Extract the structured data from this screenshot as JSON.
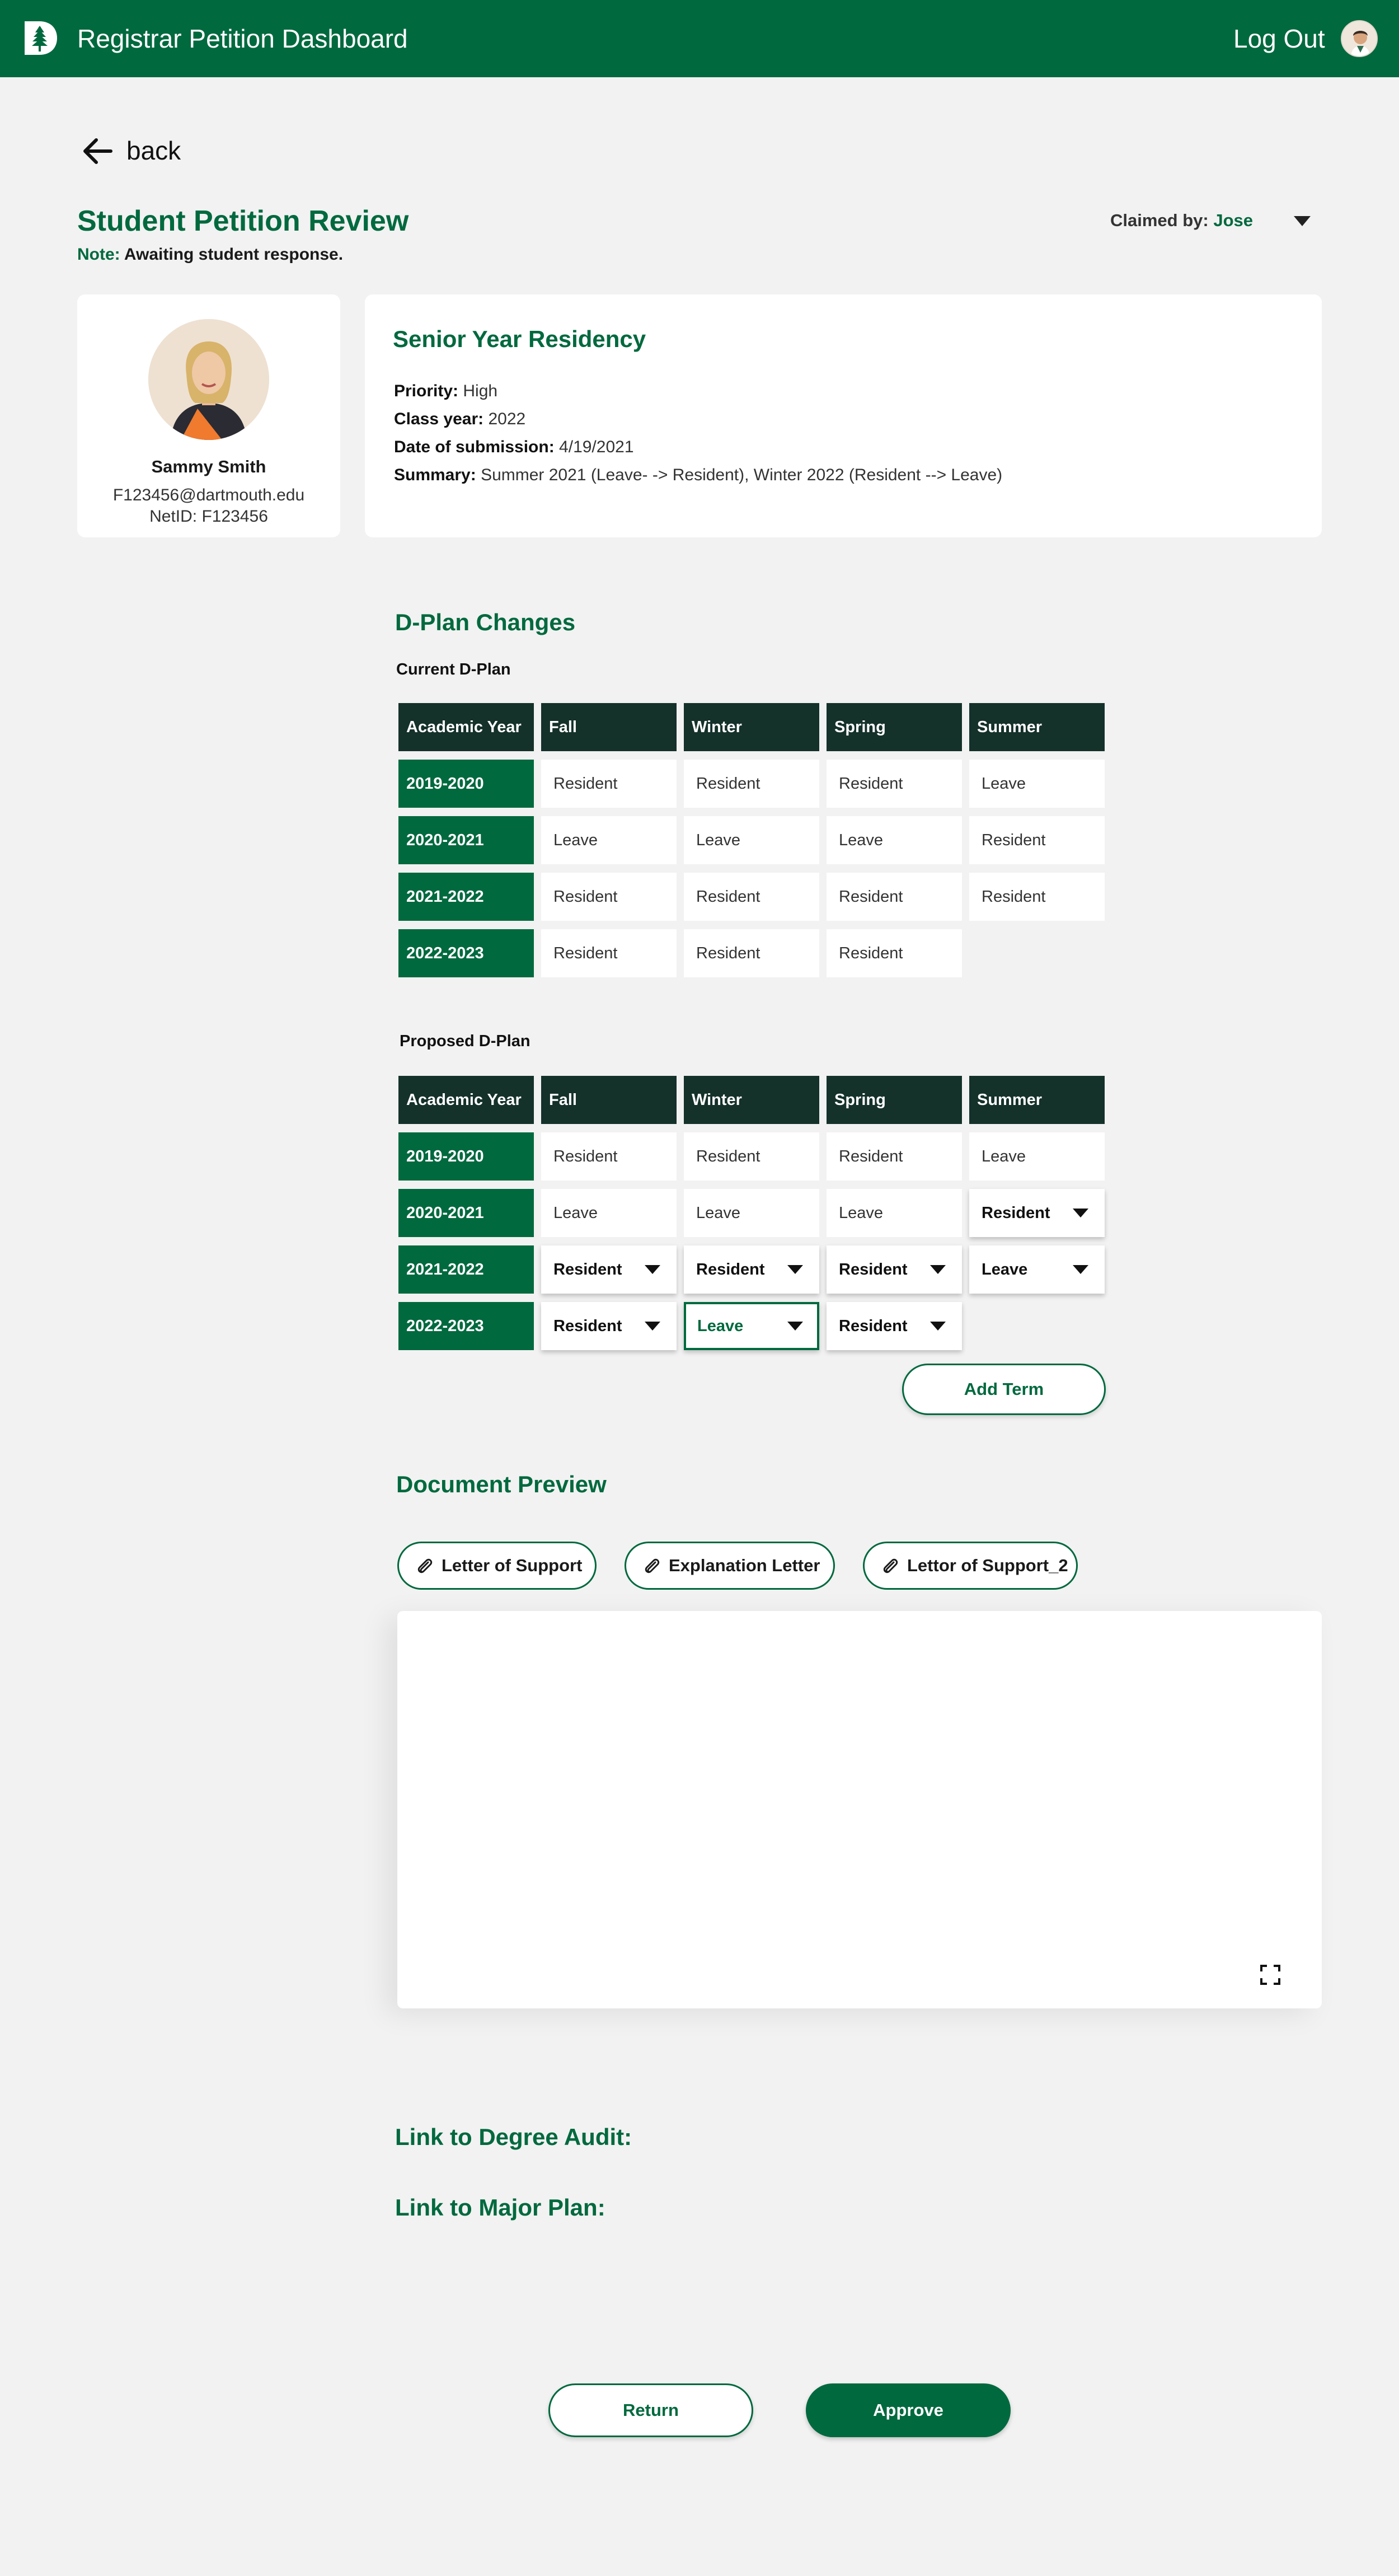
{
  "header": {
    "app_title": "Registrar Petition Dashboard",
    "logout_label": "Log Out"
  },
  "nav": {
    "back_label": "back"
  },
  "page": {
    "title": "Student Petition Review",
    "note_label": "Note:",
    "note_text": "Awaiting student response.",
    "claimed_label": "Claimed by:",
    "claimed_value": "Jose"
  },
  "student": {
    "name": "Sammy Smith",
    "email": "F123456@dartmouth.edu",
    "netid": "NetID: F123456"
  },
  "petition": {
    "title": "Senior Year Residency",
    "priority_label": "Priority:",
    "priority": "High",
    "class_year_label": "Class year:",
    "class_year": "2022",
    "submitted_label": "Date of submission:",
    "submitted": "4/19/2021",
    "summary_label": "Summary:",
    "summary": "Summer 2021 (Leave- -> Resident), Winter 2022 (Resident --> Leave)"
  },
  "dplan": {
    "section_title": "D-Plan Changes",
    "current_title": "Current D-Plan",
    "proposed_title": "Proposed D-Plan",
    "headers": [
      "Academic Year",
      "Fall",
      "Winter",
      "Spring",
      "Summer"
    ],
    "current_rows": [
      {
        "year": "2019-2020",
        "terms": [
          "Resident",
          "Resident",
          "Resident",
          "Leave"
        ]
      },
      {
        "year": "2020-2021",
        "terms": [
          "Leave",
          "Leave",
          "Leave",
          "Resident"
        ]
      },
      {
        "year": "2021-2022",
        "terms": [
          "Resident",
          "Resident",
          "Resident",
          "Resident"
        ]
      },
      {
        "year": "2022-2023",
        "terms": [
          "Resident",
          "Resident",
          "Resident"
        ]
      }
    ],
    "proposed_rows": [
      {
        "year": "2019-2020",
        "terms": [
          "Resident",
          "Resident",
          "Resident",
          "Leave"
        ]
      },
      {
        "year": "2020-2021",
        "terms": [
          "Leave",
          "Leave",
          "Leave",
          "Resident"
        ]
      },
      {
        "year": "2021-2022",
        "terms": [
          "Resident",
          "Resident",
          "Resident",
          "Leave"
        ]
      },
      {
        "year": "2022-2023",
        "terms": [
          "Resident",
          "Leave",
          "Resident"
        ]
      }
    ],
    "add_term_label": "Add Term"
  },
  "documents": {
    "section_title": "Document Preview",
    "attachments": [
      "Letter of Support",
      "Explanation Letter",
      "Lettor of Support_2"
    ]
  },
  "links": {
    "degree_audit": "Link to Degree Audit:",
    "major_plan": "Link to Major Plan:"
  },
  "actions": {
    "return_label": "Return",
    "approve_label": "Approve"
  },
  "colors": {
    "brand_green": "#00693e",
    "dark_header": "#14312a",
    "background": "#f2f2f2"
  },
  "icons": [
    "dartmouth-pine-logo",
    "user-avatar",
    "arrow-left-icon",
    "chevron-down-icon",
    "paperclip-icon",
    "expand-icon"
  ]
}
